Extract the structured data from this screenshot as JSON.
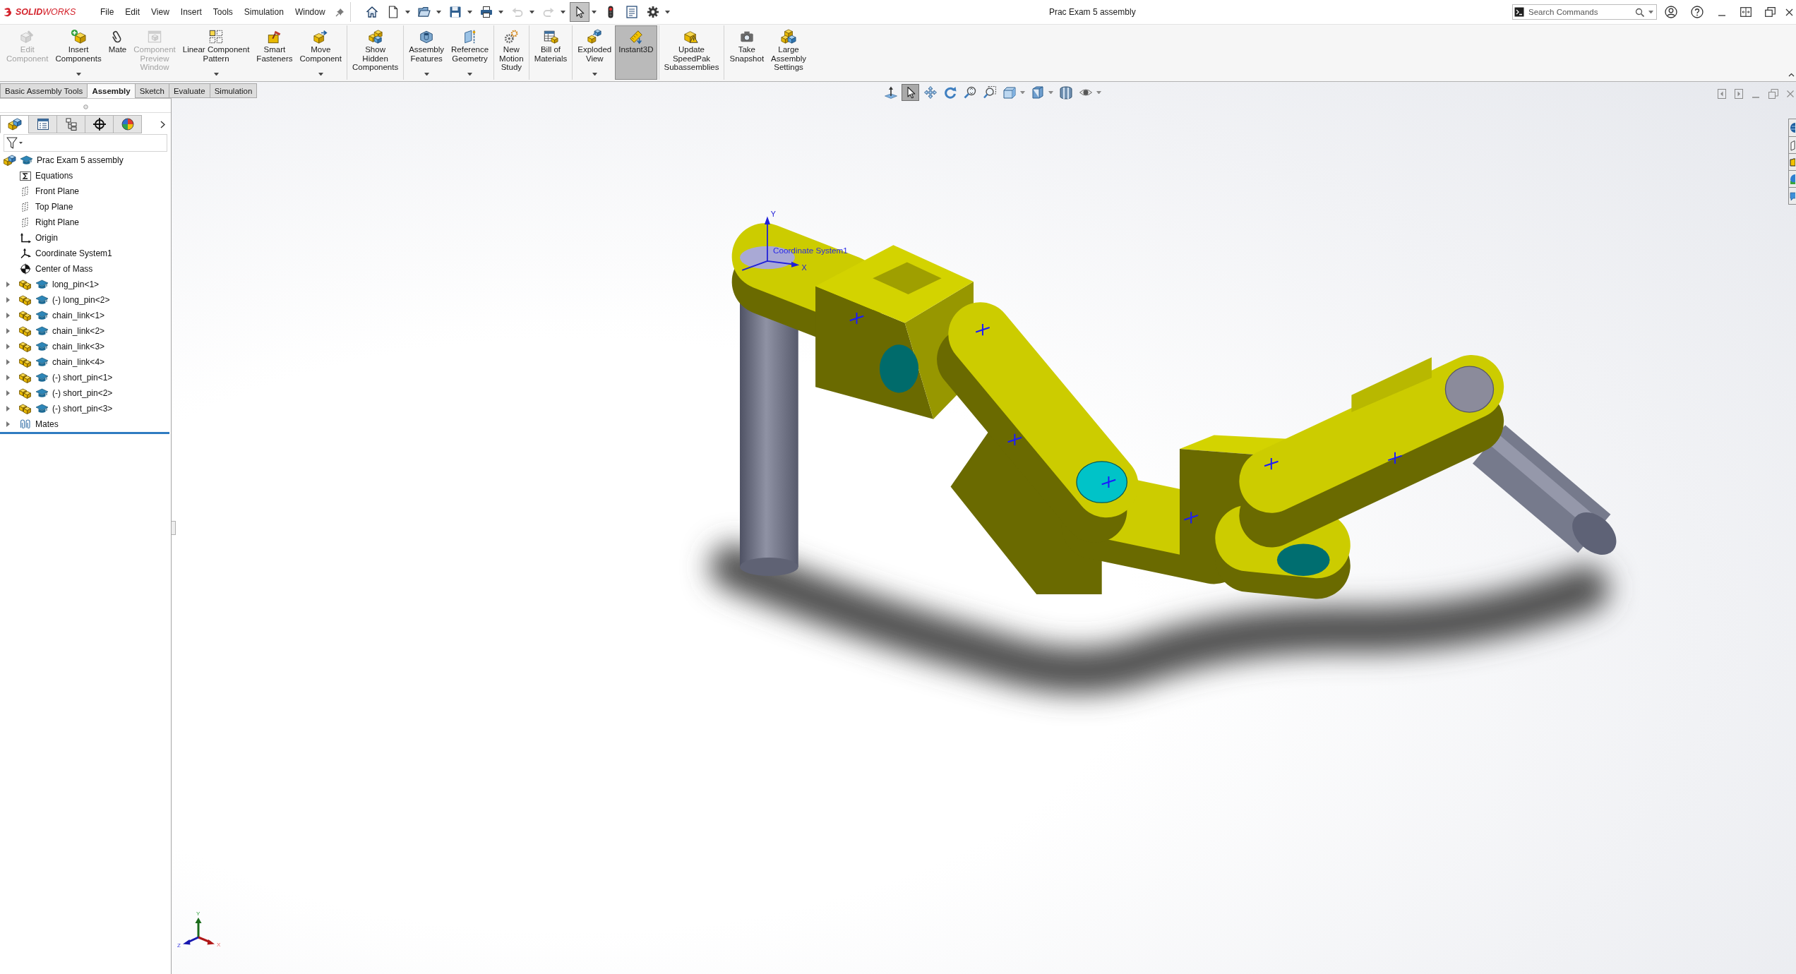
{
  "app": {
    "logo": "**SOLID**WORKS"
  },
  "menu": [
    "File",
    "Edit",
    "View",
    "Insert",
    "Tools",
    "Simulation",
    "Window"
  ],
  "quick_access": [
    {
      "kind": "home",
      "dropdown": false,
      "disabled": false,
      "selected": false
    },
    {
      "kind": "new",
      "dropdown": true,
      "disabled": false,
      "selected": false
    },
    {
      "kind": "open",
      "dropdown": true,
      "disabled": false,
      "selected": false
    },
    {
      "kind": "save",
      "dropdown": true,
      "disabled": false,
      "selected": false
    },
    {
      "kind": "print",
      "dropdown": true,
      "disabled": false,
      "selected": false
    },
    {
      "kind": "undo",
      "dropdown": true,
      "disabled": true,
      "selected": false
    },
    {
      "kind": "redo",
      "dropdown": true,
      "disabled": true,
      "selected": false
    },
    {
      "kind": "select",
      "dropdown": true,
      "disabled": false,
      "selected": true
    },
    {
      "kind": "rebuild",
      "dropdown": false,
      "disabled": false,
      "selected": false
    },
    {
      "kind": "file-properties",
      "dropdown": false,
      "disabled": false,
      "selected": false
    },
    {
      "kind": "options",
      "dropdown": true,
      "disabled": false,
      "selected": false
    }
  ],
  "window": {
    "title": "Prac Exam 5 assembly"
  },
  "search": {
    "placeholder": "Search Commands"
  },
  "ribbon": {
    "groups": [
      {
        "buttons": [
          {
            "kind": "edit-component",
            "label": "Edit\nComponent",
            "disabled": true,
            "on": false,
            "dropdown": false
          },
          {
            "kind": "insert-components",
            "label": "Insert\nComponents",
            "disabled": false,
            "on": false,
            "dropdown": true
          },
          {
            "kind": "mate",
            "label": "Mate",
            "disabled": false,
            "on": false,
            "dropdown": false
          },
          {
            "kind": "component-preview",
            "label": "Component\nPreview\nWindow",
            "disabled": true,
            "on": false,
            "dropdown": false
          },
          {
            "kind": "linear-pattern",
            "label": "Linear Component\nPattern",
            "disabled": false,
            "on": false,
            "dropdown": true
          },
          {
            "kind": "smart-fasteners",
            "label": "Smart\nFasteners",
            "disabled": false,
            "on": false,
            "dropdown": false
          },
          {
            "kind": "move-component",
            "label": "Move\nComponent",
            "disabled": false,
            "on": false,
            "dropdown": true
          }
        ]
      },
      {
        "buttons": [
          {
            "kind": "show-hidden",
            "label": "Show\nHidden\nComponents",
            "disabled": false,
            "on": false,
            "dropdown": false
          }
        ]
      },
      {
        "buttons": [
          {
            "kind": "assembly-features",
            "label": "Assembly\nFeatures",
            "disabled": false,
            "on": false,
            "dropdown": true
          },
          {
            "kind": "reference-geometry",
            "label": "Reference\nGeometry",
            "disabled": false,
            "on": false,
            "dropdown": true
          }
        ]
      },
      {
        "buttons": [
          {
            "kind": "motion-study",
            "label": "New\nMotion\nStudy",
            "disabled": false,
            "on": false,
            "dropdown": false
          }
        ]
      },
      {
        "buttons": [
          {
            "kind": "bill-of-materials",
            "label": "Bill of\nMaterials",
            "disabled": false,
            "on": false,
            "dropdown": false
          }
        ]
      },
      {
        "buttons": [
          {
            "kind": "exploded-view",
            "label": "Exploded\nView",
            "disabled": false,
            "on": false,
            "dropdown": true
          },
          {
            "kind": "instant3d",
            "label": "Instant3D",
            "disabled": false,
            "on": true,
            "dropdown": false
          }
        ]
      },
      {
        "buttons": [
          {
            "kind": "speedpak",
            "label": "Update\nSpeedPak\nSubassemblies",
            "disabled": false,
            "on": false,
            "dropdown": false
          }
        ]
      },
      {
        "buttons": [
          {
            "kind": "snapshot",
            "label": "Take\nSnapshot",
            "disabled": false,
            "on": false,
            "dropdown": false
          },
          {
            "kind": "large-assembly",
            "label": "Large\nAssembly\nSettings",
            "disabled": false,
            "on": false,
            "dropdown": false
          }
        ]
      }
    ]
  },
  "command_tabs": [
    {
      "label": "Basic Assembly Tools",
      "selected": false
    },
    {
      "label": "Assembly",
      "selected": true
    },
    {
      "label": "Sketch",
      "selected": false
    },
    {
      "label": "Evaluate",
      "selected": false
    },
    {
      "label": "Simulation",
      "selected": false
    }
  ],
  "feature_manager": {
    "tabs": [
      {
        "kind": "features",
        "selected": true
      },
      {
        "kind": "properties",
        "selected": false
      },
      {
        "kind": "configurations",
        "selected": false
      },
      {
        "kind": "dimxpert",
        "selected": false
      },
      {
        "kind": "display",
        "selected": false
      }
    ],
    "tree": {
      "label": "Prac Exam 5 assembly",
      "kind": "assembly",
      "children": [
        {
          "label": "Equations",
          "kind": "equations"
        },
        {
          "label": "Front Plane",
          "kind": "plane"
        },
        {
          "label": "Top Plane",
          "kind": "plane"
        },
        {
          "label": "Right Plane",
          "kind": "plane"
        },
        {
          "label": "Origin",
          "kind": "origin"
        },
        {
          "label": "Coordinate System1",
          "kind": "coordinate-system"
        },
        {
          "label": "Center of Mass",
          "kind": "center-of-mass"
        },
        {
          "label": "long_pin<1>",
          "kind": "component",
          "expanded": false
        },
        {
          "label": "(-) long_pin<2>",
          "kind": "component",
          "expanded": false
        },
        {
          "label": "chain_link<1>",
          "kind": "component",
          "expanded": false
        },
        {
          "label": "chain_link<2>",
          "kind": "component",
          "expanded": false
        },
        {
          "label": "chain_link<3>",
          "kind": "component",
          "expanded": false
        },
        {
          "label": "chain_link<4>",
          "kind": "component",
          "expanded": false
        },
        {
          "label": "(-) short_pin<1>",
          "kind": "component",
          "expanded": false
        },
        {
          "label": "(-) short_pin<2>",
          "kind": "component",
          "expanded": false
        },
        {
          "label": "(-) short_pin<3>",
          "kind": "component",
          "expanded": false
        },
        {
          "label": "Mates",
          "kind": "mates",
          "expanded": false
        }
      ]
    }
  },
  "viewport": {
    "heads_up": [
      {
        "kind": "normal-to",
        "selected": false,
        "dropdown": false
      },
      {
        "kind": "select",
        "selected": true,
        "dropdown": false
      },
      {
        "kind": "pan",
        "selected": false,
        "dropdown": false
      },
      {
        "kind": "rotate",
        "selected": false,
        "dropdown": false
      },
      {
        "kind": "zoom-fit",
        "selected": false,
        "dropdown": false
      },
      {
        "kind": "zoom-area",
        "selected": false,
        "dropdown": false
      },
      {
        "kind": "view-orientation",
        "selected": false,
        "dropdown": true
      },
      {
        "kind": "display-style",
        "selected": false,
        "dropdown": true
      },
      {
        "kind": "section-view",
        "selected": false,
        "dropdown": false
      },
      {
        "kind": "hide-show",
        "selected": false,
        "dropdown": true
      }
    ],
    "coordinate_system": {
      "label": "Coordinate System1",
      "y": "Y",
      "x": "X"
    },
    "triad": {
      "y": "Y",
      "z": "Z",
      "x": "X"
    }
  }
}
